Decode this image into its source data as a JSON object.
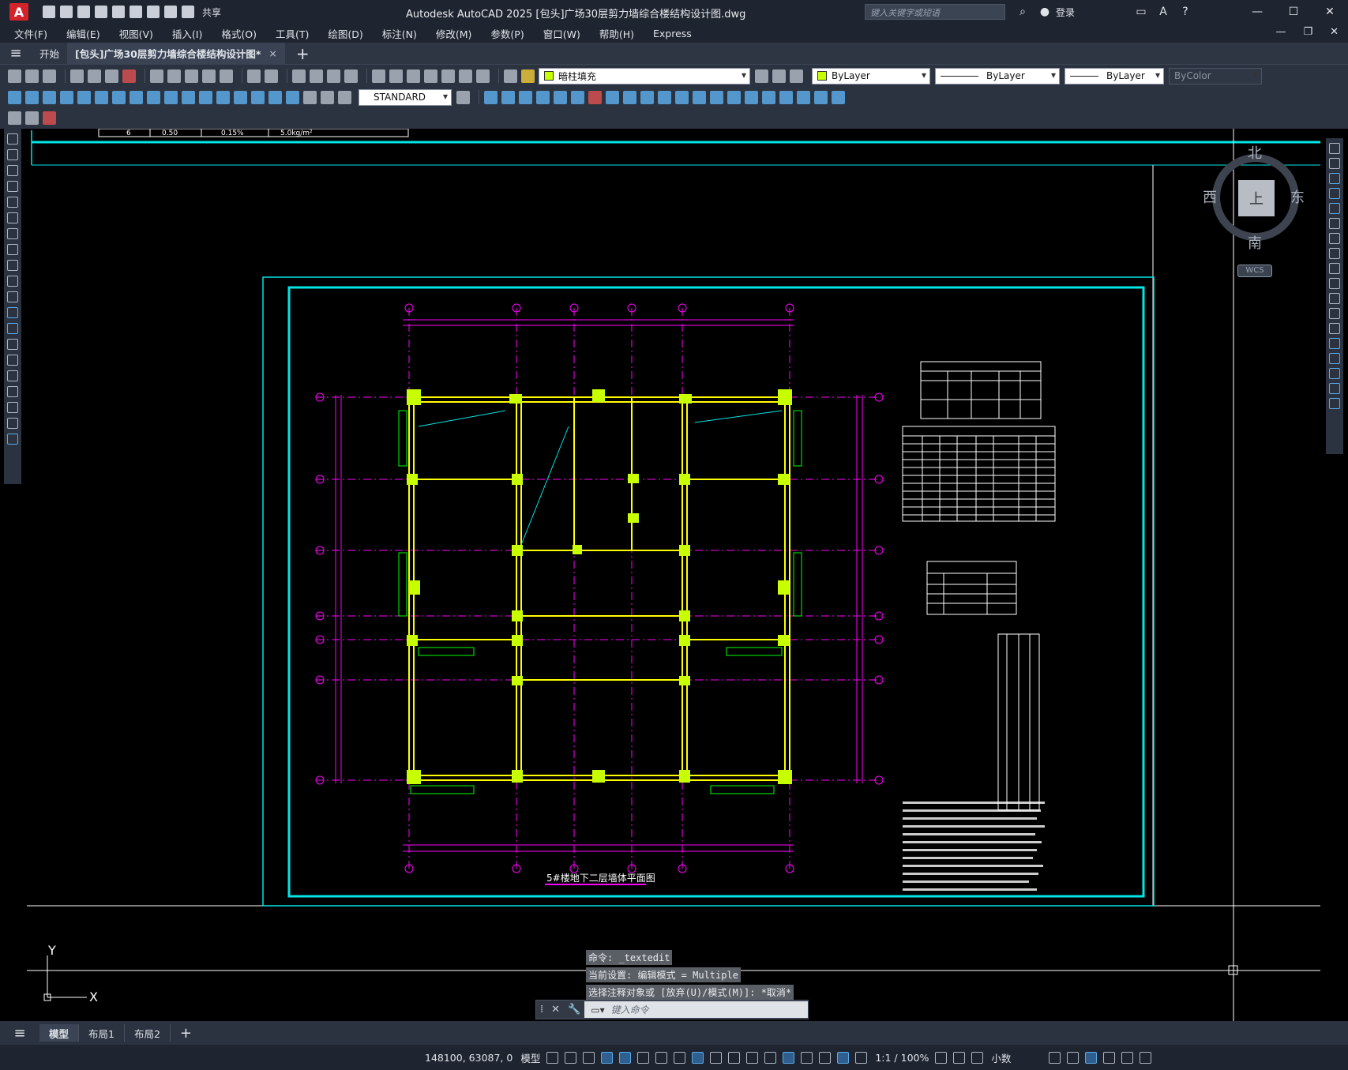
{
  "app": {
    "logo": "A",
    "title": "Autodesk AutoCAD 2025    [包头]广场30层剪力墙综合楼结构设计图.dwg",
    "share": "共享",
    "search_placeholder": "键入关键字或短语",
    "login": "登录"
  },
  "menu": [
    "文件(F)",
    "编辑(E)",
    "视图(V)",
    "插入(I)",
    "格式(O)",
    "工具(T)",
    "绘图(D)",
    "标注(N)",
    "修改(M)",
    "参数(P)",
    "窗口(W)",
    "帮助(H)",
    "Express"
  ],
  "tabs": {
    "start": "开始",
    "document": "[包头]广场30层剪力墙综合楼结构设计图*",
    "close": "×",
    "add": "+"
  },
  "toolbar": {
    "layer_name": "暗柱填充",
    "color": "ByLayer",
    "linetype": "ByLayer",
    "lineweight": "ByLayer",
    "plotstyle": "ByColor",
    "text_style": "STANDARD"
  },
  "viewcube": {
    "north": "北",
    "south": "南",
    "east": "东",
    "west": "西",
    "face": "上",
    "wcs": "WCS"
  },
  "drawing": {
    "plan_title": "5#楼地下二层墙体平面图",
    "ucs_x": "X",
    "ucs_y": "Y",
    "top_table_row": [
      "6",
      "0.50",
      "0.15%",
      "5.0kg/m²"
    ]
  },
  "command": {
    "history": [
      "命令: _textedit",
      "当前设置: 编辑模式 = Multiple",
      "选择注释对象或 [放弃(U)/模式(M)]: *取消*"
    ],
    "placeholder": "键入命令"
  },
  "layouts": [
    "模型",
    "布局1",
    "布局2"
  ],
  "status": {
    "coords": "148100, 63087, 0",
    "mode": "模型",
    "scale": "1:1 / 100%",
    "units": "小数"
  },
  "colors": {
    "accent_cyan": "#00e5e5",
    "wall_yellow": "#ffff00",
    "column_fill": "#c8ff00",
    "grid_magenta": "#ff00ff",
    "dim_green": "#00ff00"
  }
}
